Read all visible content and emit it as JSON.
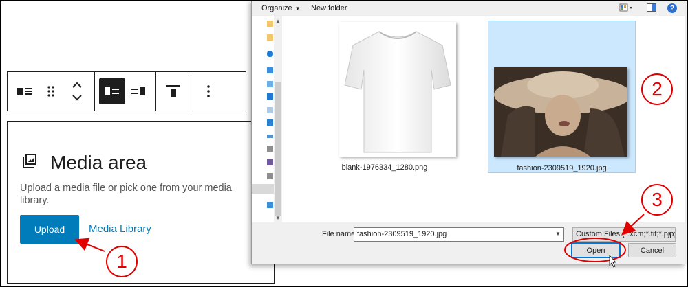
{
  "wp": {
    "toolbar": {
      "buttons": [
        {
          "name": "block-type-icon"
        },
        {
          "name": "drag-handle-icon"
        },
        {
          "name": "move-up-down-icon"
        },
        {
          "name": "media-left-icon"
        },
        {
          "name": "media-right-icon"
        },
        {
          "name": "align-top-icon"
        },
        {
          "name": "more-options-icon"
        }
      ]
    },
    "block": {
      "title": "Media area",
      "instructions": "Upload a media file or pick one from your media library.",
      "upload_label": "Upload",
      "media_library_label": "Media Library",
      "accent_color": "#007cba"
    }
  },
  "dialog": {
    "toolbar": {
      "organize_label": "Organize",
      "new_folder_label": "New folder",
      "help_glyph": "?"
    },
    "files": [
      {
        "name": "blank-1976334_1280.png",
        "selected": false
      },
      {
        "name": "fashion-2309519_1920.jpg",
        "selected": true
      }
    ],
    "file_name_label": "File name:",
    "file_name_value": "fashion-2309519_1920.jpg",
    "file_type_value": "Custom Files (*.xcm;*.tif;*.pjp;*",
    "open_label": "Open",
    "cancel_label": "Cancel",
    "selection_color": "#cce8ff"
  },
  "annotations": {
    "step1": "1",
    "step2": "2",
    "step3": "3",
    "color": "#e00000"
  }
}
